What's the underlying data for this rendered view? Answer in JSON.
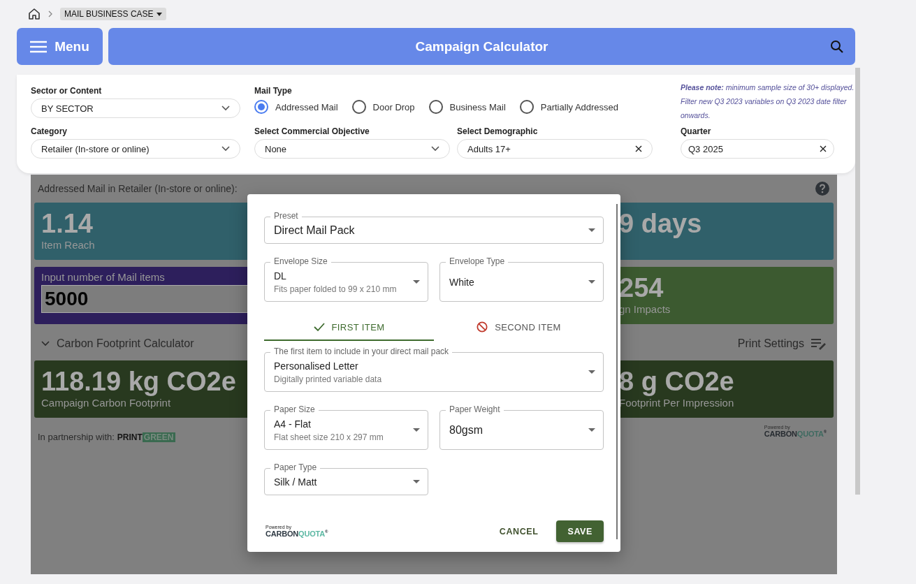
{
  "breadcrumb": {
    "label": "MAIL BUSINESS CASE"
  },
  "menu_button": {
    "label": "Menu"
  },
  "header": {
    "title": "Campaign Calculator"
  },
  "filters": {
    "sector": {
      "label": "Sector or Content",
      "value": "BY SECTOR"
    },
    "mail_type": {
      "label": "Mail Type",
      "options": [
        {
          "label": "Addressed Mail",
          "selected": true
        },
        {
          "label": "Door Drop",
          "selected": false
        },
        {
          "label": "Business Mail",
          "selected": false
        },
        {
          "label": "Partially Addressed",
          "selected": false
        }
      ]
    },
    "note": "**Please note:** minimum sample size of 30+ displayed. Filter new Q3 2023 variables on Q3 2023 date filter onwards.",
    "category": {
      "label": "Category",
      "value": "Retailer (In-store or online)"
    },
    "objective": {
      "label": "Select Commercial Objective",
      "value": "None"
    },
    "demographic": {
      "label": "Select Demographic",
      "value": "Adults 17+"
    },
    "quarter": {
      "label": "Quarter",
      "value": "Q3 2025"
    }
  },
  "results": {
    "heading": "Addressed Mail in Retailer (In-store or online):",
    "cards": [
      {
        "kind": "stat",
        "color": "#30606a",
        "left_value": "1.14",
        "left_label": "Item Reach",
        "right_value": "9 days"
      },
      {
        "kind": "input",
        "color": "#2d1f5c",
        "left_label": "Input number of Mail items",
        "input_value": "5000",
        "right": {
          "color": "#3c5a30",
          "value": "254",
          "label": "gn Impacts"
        }
      }
    ],
    "calculator_toggle": "Carbon Footprint Calculator",
    "print_settings": "Print Settings",
    "footprint_card": {
      "color": "#28391f",
      "left_value": "118.19 kg CO2e",
      "left_label": "Campaign Carbon Footprint",
      "right_value": "8 g CO2e",
      "right_label": "Footprint Per Impression"
    },
    "partnership": {
      "text": "In partnership with:",
      "logo_part_1": "PRINT",
      "logo_part_2": "GREEN"
    },
    "powered_by": {
      "text": "Powered by",
      "brand_1": "CARBON",
      "brand_2": "QUOTA",
      "mark": "®"
    }
  },
  "dialog": {
    "preset": {
      "label": "Preset",
      "value": "Direct Mail Pack"
    },
    "envelope_size": {
      "label": "Envelope Size",
      "value": "DL",
      "hint": "Fits paper folded to 99 x 210 mm"
    },
    "envelope_type": {
      "label": "Envelope Type",
      "value": "White"
    },
    "tabs": [
      {
        "label": "FIRST ITEM",
        "kind": "included",
        "selected": true
      },
      {
        "label": "SECOND ITEM",
        "kind": "excluded",
        "selected": false
      }
    ],
    "item": {
      "label": "The first item to include in your direct mail pack",
      "value": "Personalised Letter",
      "hint": "Digitally printed variable data"
    },
    "paper_size": {
      "label": "Paper Size",
      "value": "A4 - Flat",
      "hint": "Flat sheet size 210 x 297 mm"
    },
    "paper_weight": {
      "label": "Paper Weight",
      "value": "80gsm"
    },
    "paper_type": {
      "label": "Paper Type",
      "value": "Silk / Matt"
    },
    "powered_by": {
      "text": "Powered by",
      "brand_1": "CARBON",
      "brand_2": "QUOTA",
      "mark": "®"
    },
    "cancel": "CANCEL",
    "save": "SAVE"
  }
}
